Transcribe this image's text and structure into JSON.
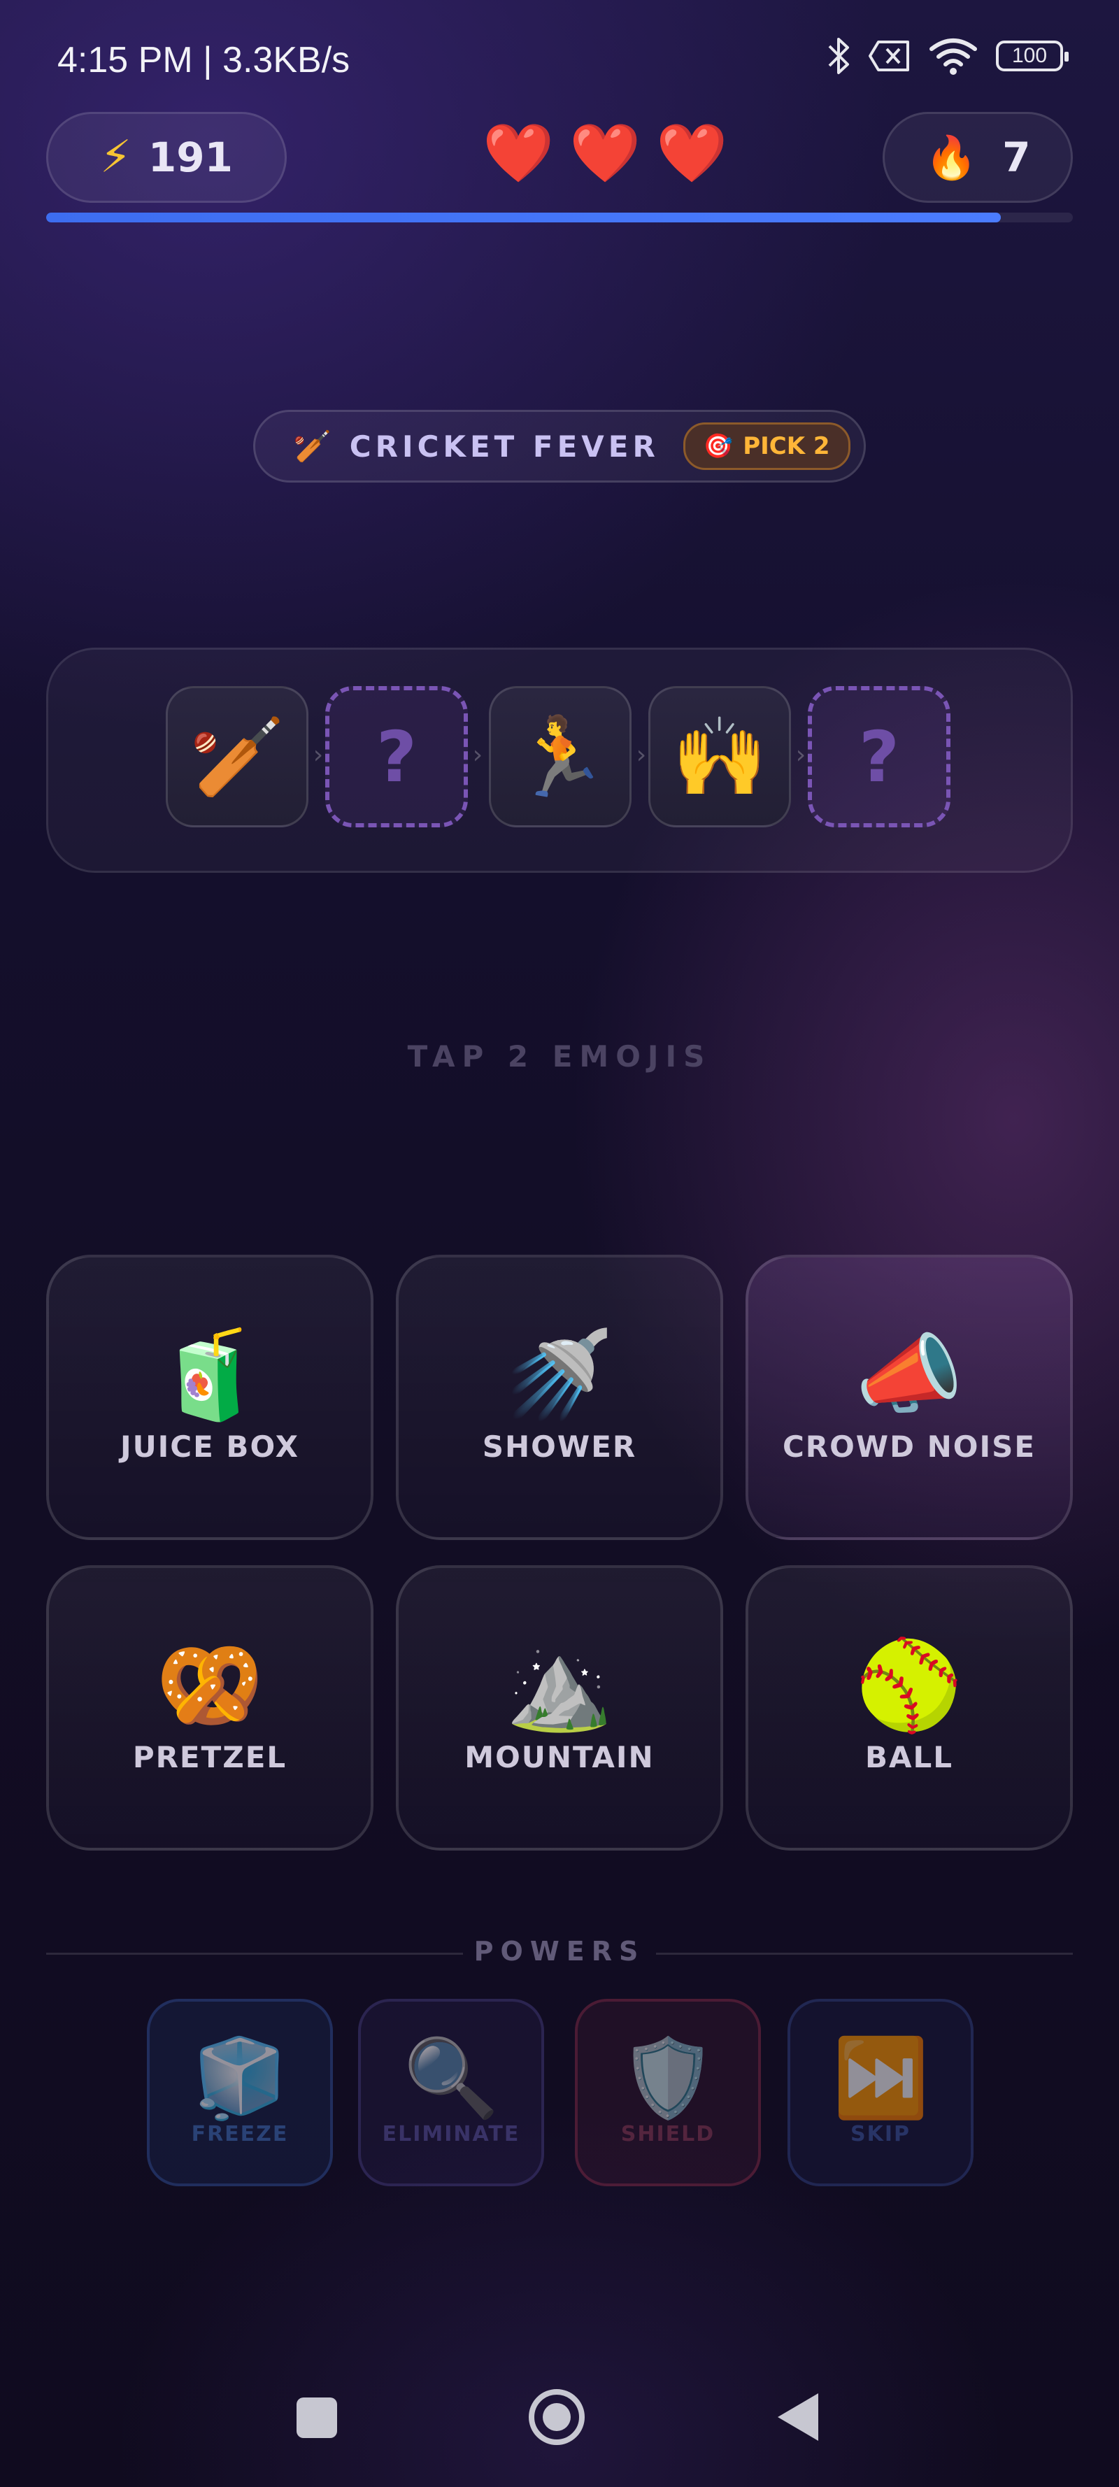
{
  "status_bar": {
    "time": "4:15 PM | 3.3KB/s",
    "battery": "100",
    "icons": [
      "bluetooth-icon",
      "no-sim-icon",
      "wifi-icon",
      "battery-icon"
    ]
  },
  "hud": {
    "energy_icon": "⚡",
    "energy": "191",
    "hearts": [
      "❤️",
      "❤️",
      "❤️"
    ],
    "streak_icon": "🔥",
    "streak": "7",
    "progress_fraction": 0.93
  },
  "category": {
    "icon": "🏏",
    "label": "CRICKET FEVER",
    "pick_icon": "🎯",
    "pick_label": "PICK 2"
  },
  "sequence": {
    "tiles": [
      {
        "type": "filled",
        "emoji": "🏏"
      },
      {
        "type": "empty",
        "emoji": "?"
      },
      {
        "type": "filled",
        "emoji": "🏃"
      },
      {
        "type": "filled",
        "emoji": "🙌"
      },
      {
        "type": "empty",
        "emoji": "?"
      }
    ],
    "separator": "›"
  },
  "instruction": "TAP 2 EMOJIS",
  "options": [
    {
      "emoji": "🧃",
      "label": "JUICE BOX"
    },
    {
      "emoji": "🚿",
      "label": "SHOWER"
    },
    {
      "emoji": "📣",
      "label": "CROWD NOISE"
    },
    {
      "emoji": "🥨",
      "label": "PRETZEL"
    },
    {
      "emoji": "⛰️",
      "label": "MOUNTAIN"
    },
    {
      "emoji": "🥎",
      "label": "BALL"
    }
  ],
  "powers": {
    "title": "POWERS",
    "items": [
      {
        "emoji": "🧊",
        "label": "FREEZE"
      },
      {
        "emoji": "🔍",
        "label": "ELIMINATE"
      },
      {
        "emoji": "🛡️",
        "label": "SHIELD"
      },
      {
        "emoji": "⏭️",
        "label": "SKIP"
      }
    ]
  },
  "colors": {
    "accent_blue": "#4b7cff",
    "pick_orange": "#ffb638",
    "heart_red": "#ff3b47",
    "dashed_purple": "#7a55b5"
  }
}
